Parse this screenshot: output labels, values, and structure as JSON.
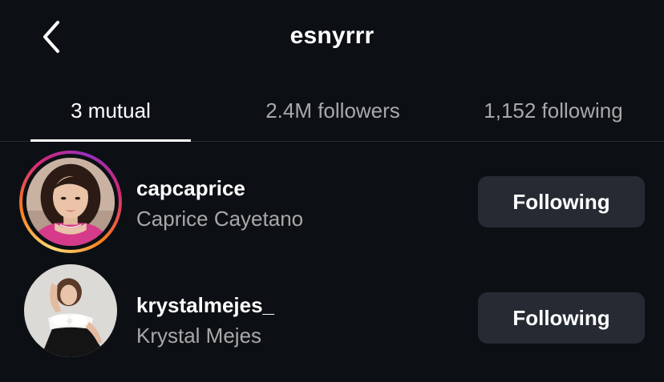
{
  "header": {
    "title": "esnyrrr",
    "back_icon": "chevron-left-icon"
  },
  "tabs": [
    {
      "label": "3 mutual",
      "active": true
    },
    {
      "label": "2.4M followers",
      "active": false
    },
    {
      "label": "1,152 following",
      "active": false
    }
  ],
  "users": [
    {
      "username": "capcaprice",
      "full_name": "Caprice Cayetano",
      "button_label": "Following",
      "has_story_ring": true
    },
    {
      "username": "krystalmejes_",
      "full_name": "Krystal Mejes",
      "button_label": "Following",
      "has_story_ring": false
    }
  ],
  "colors": {
    "background": "#0c1014",
    "button_bg": "#262b33",
    "secondary_text": "#a8a8a8",
    "primary_text": "#ffffff"
  }
}
